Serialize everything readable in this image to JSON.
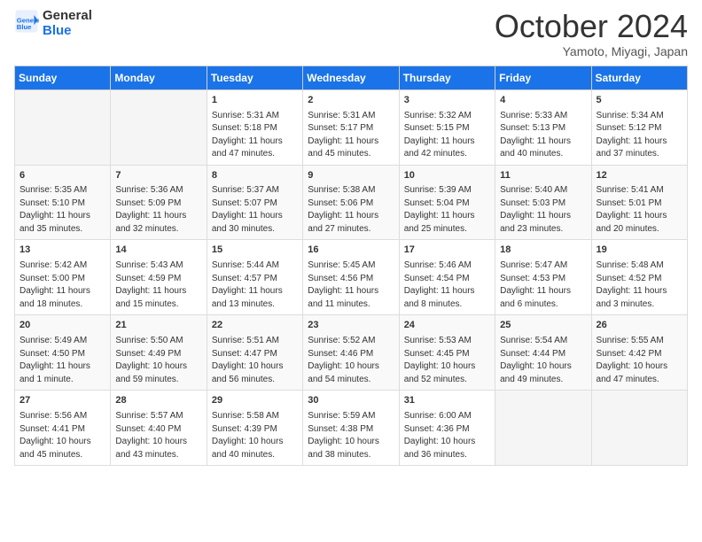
{
  "header": {
    "logo_line1": "General",
    "logo_line2": "Blue",
    "month": "October 2024",
    "location": "Yamoto, Miyagi, Japan"
  },
  "days_of_week": [
    "Sunday",
    "Monday",
    "Tuesday",
    "Wednesday",
    "Thursday",
    "Friday",
    "Saturday"
  ],
  "weeks": [
    [
      {
        "day": "",
        "info": ""
      },
      {
        "day": "",
        "info": ""
      },
      {
        "day": "1",
        "info": "Sunrise: 5:31 AM\nSunset: 5:18 PM\nDaylight: 11 hours and 47 minutes."
      },
      {
        "day": "2",
        "info": "Sunrise: 5:31 AM\nSunset: 5:17 PM\nDaylight: 11 hours and 45 minutes."
      },
      {
        "day": "3",
        "info": "Sunrise: 5:32 AM\nSunset: 5:15 PM\nDaylight: 11 hours and 42 minutes."
      },
      {
        "day": "4",
        "info": "Sunrise: 5:33 AM\nSunset: 5:13 PM\nDaylight: 11 hours and 40 minutes."
      },
      {
        "day": "5",
        "info": "Sunrise: 5:34 AM\nSunset: 5:12 PM\nDaylight: 11 hours and 37 minutes."
      }
    ],
    [
      {
        "day": "6",
        "info": "Sunrise: 5:35 AM\nSunset: 5:10 PM\nDaylight: 11 hours and 35 minutes."
      },
      {
        "day": "7",
        "info": "Sunrise: 5:36 AM\nSunset: 5:09 PM\nDaylight: 11 hours and 32 minutes."
      },
      {
        "day": "8",
        "info": "Sunrise: 5:37 AM\nSunset: 5:07 PM\nDaylight: 11 hours and 30 minutes."
      },
      {
        "day": "9",
        "info": "Sunrise: 5:38 AM\nSunset: 5:06 PM\nDaylight: 11 hours and 27 minutes."
      },
      {
        "day": "10",
        "info": "Sunrise: 5:39 AM\nSunset: 5:04 PM\nDaylight: 11 hours and 25 minutes."
      },
      {
        "day": "11",
        "info": "Sunrise: 5:40 AM\nSunset: 5:03 PM\nDaylight: 11 hours and 23 minutes."
      },
      {
        "day": "12",
        "info": "Sunrise: 5:41 AM\nSunset: 5:01 PM\nDaylight: 11 hours and 20 minutes."
      }
    ],
    [
      {
        "day": "13",
        "info": "Sunrise: 5:42 AM\nSunset: 5:00 PM\nDaylight: 11 hours and 18 minutes."
      },
      {
        "day": "14",
        "info": "Sunrise: 5:43 AM\nSunset: 4:59 PM\nDaylight: 11 hours and 15 minutes."
      },
      {
        "day": "15",
        "info": "Sunrise: 5:44 AM\nSunset: 4:57 PM\nDaylight: 11 hours and 13 minutes."
      },
      {
        "day": "16",
        "info": "Sunrise: 5:45 AM\nSunset: 4:56 PM\nDaylight: 11 hours and 11 minutes."
      },
      {
        "day": "17",
        "info": "Sunrise: 5:46 AM\nSunset: 4:54 PM\nDaylight: 11 hours and 8 minutes."
      },
      {
        "day": "18",
        "info": "Sunrise: 5:47 AM\nSunset: 4:53 PM\nDaylight: 11 hours and 6 minutes."
      },
      {
        "day": "19",
        "info": "Sunrise: 5:48 AM\nSunset: 4:52 PM\nDaylight: 11 hours and 3 minutes."
      }
    ],
    [
      {
        "day": "20",
        "info": "Sunrise: 5:49 AM\nSunset: 4:50 PM\nDaylight: 11 hours and 1 minute."
      },
      {
        "day": "21",
        "info": "Sunrise: 5:50 AM\nSunset: 4:49 PM\nDaylight: 10 hours and 59 minutes."
      },
      {
        "day": "22",
        "info": "Sunrise: 5:51 AM\nSunset: 4:47 PM\nDaylight: 10 hours and 56 minutes."
      },
      {
        "day": "23",
        "info": "Sunrise: 5:52 AM\nSunset: 4:46 PM\nDaylight: 10 hours and 54 minutes."
      },
      {
        "day": "24",
        "info": "Sunrise: 5:53 AM\nSunset: 4:45 PM\nDaylight: 10 hours and 52 minutes."
      },
      {
        "day": "25",
        "info": "Sunrise: 5:54 AM\nSunset: 4:44 PM\nDaylight: 10 hours and 49 minutes."
      },
      {
        "day": "26",
        "info": "Sunrise: 5:55 AM\nSunset: 4:42 PM\nDaylight: 10 hours and 47 minutes."
      }
    ],
    [
      {
        "day": "27",
        "info": "Sunrise: 5:56 AM\nSunset: 4:41 PM\nDaylight: 10 hours and 45 minutes."
      },
      {
        "day": "28",
        "info": "Sunrise: 5:57 AM\nSunset: 4:40 PM\nDaylight: 10 hours and 43 minutes."
      },
      {
        "day": "29",
        "info": "Sunrise: 5:58 AM\nSunset: 4:39 PM\nDaylight: 10 hours and 40 minutes."
      },
      {
        "day": "30",
        "info": "Sunrise: 5:59 AM\nSunset: 4:38 PM\nDaylight: 10 hours and 38 minutes."
      },
      {
        "day": "31",
        "info": "Sunrise: 6:00 AM\nSunset: 4:36 PM\nDaylight: 10 hours and 36 minutes."
      },
      {
        "day": "",
        "info": ""
      },
      {
        "day": "",
        "info": ""
      }
    ]
  ]
}
